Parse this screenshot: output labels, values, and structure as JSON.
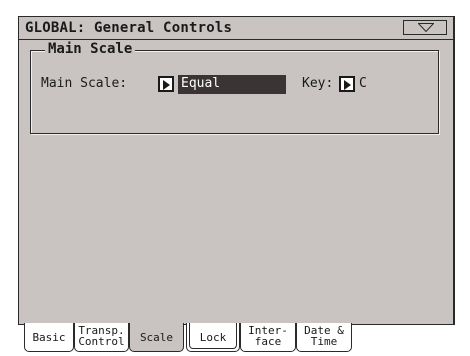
{
  "header": {
    "title": "GLOBAL: General Controls"
  },
  "main_scale_group": {
    "title": "Main Scale",
    "scale_label": "Main Scale:",
    "scale_value": "Equal",
    "key_label": "Key:",
    "key_value": "C"
  },
  "tabs": [
    {
      "line1": "Basic",
      "line2": ""
    },
    {
      "line1": "Transp.",
      "line2": "Control"
    },
    {
      "line1": "Scale",
      "line2": ""
    },
    {
      "line1": "Lock",
      "line2": ""
    },
    {
      "line1": "Inter-",
      "line2": "face"
    },
    {
      "line1": "Date &",
      "line2": "Time"
    }
  ],
  "active_tab": "Scale",
  "icons": {
    "menu": "triangle-down-icon",
    "scale_arrow": "triangle-right-icon",
    "key_arrow": "triangle-right-icon"
  },
  "colors": {
    "panel": "#c9c4c2",
    "selected_field": "#3a3434"
  }
}
